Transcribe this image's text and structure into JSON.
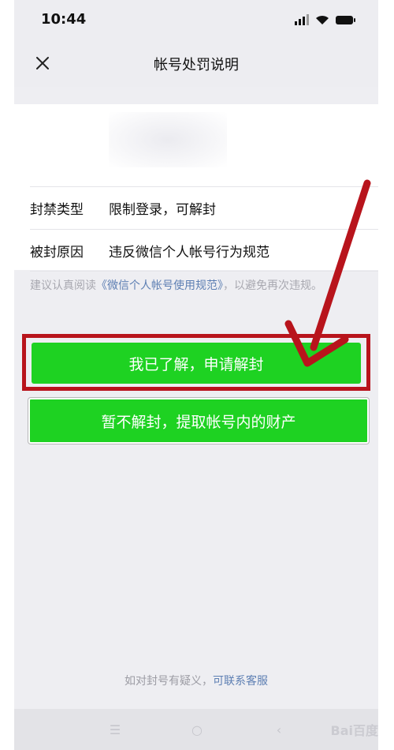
{
  "status_bar": {
    "time": "10:44"
  },
  "nav": {
    "title": "帐号处罚说明"
  },
  "info": {
    "rows": [
      {
        "label": "封禁类型",
        "value": "限制登录，可解封"
      },
      {
        "label": "被封原因",
        "value": "违反微信个人帐号行为规范"
      }
    ]
  },
  "hint": {
    "prefix": "建议认真阅读",
    "link": "《微信个人帐号使用规范》",
    "suffix": "，以避免再次违规。"
  },
  "buttons": {
    "primary": "我已了解，申请解封",
    "secondary": "暂不解封，提取帐号内的财产"
  },
  "footer": {
    "prefix": "如对封号有疑义，",
    "link": "可联系客服"
  },
  "system_keys": {
    "menu": "☰",
    "home": "○",
    "back": "‹"
  },
  "watermark": "Bai百度",
  "colors": {
    "button_green": "#1ed222",
    "highlight_red": "#b8141c",
    "link_blue": "#5d7fb3"
  },
  "icons": {
    "close": "close-icon",
    "signal": "signal-icon",
    "wifi": "wifi-icon",
    "battery": "battery-icon"
  }
}
